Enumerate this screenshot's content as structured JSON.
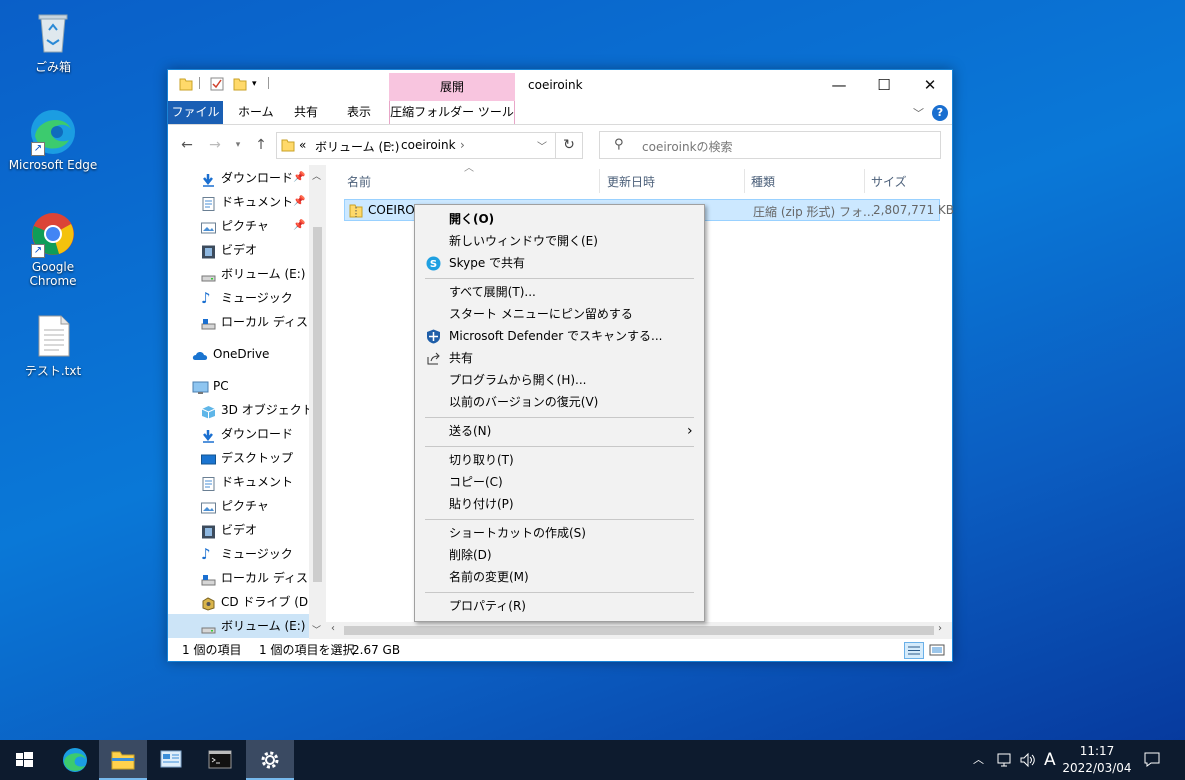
{
  "desktop": {
    "icons": [
      {
        "label": "ごみ箱"
      },
      {
        "label": "Microsoft Edge"
      },
      {
        "label": "Google Chrome"
      },
      {
        "label": "テスト.txt"
      }
    ]
  },
  "window": {
    "title": "coeiroink",
    "context_tab_header": "展開",
    "ribbon_tabs": [
      "ファイル",
      "ホーム",
      "共有",
      "表示"
    ],
    "context_tab": "圧縮フォルダー ツール",
    "help": "?",
    "address": {
      "overflow": "«",
      "crumbs": [
        "ボリューム (E:)",
        "coeiroink"
      ]
    },
    "search_placeholder": "coeiroinkの検索",
    "nav": {
      "quick": [
        "ダウンロード",
        "ドキュメント",
        "ピクチャ",
        "ビデオ",
        "ボリューム (E:)",
        "ミュージック",
        "ローカル ディスク (C"
      ],
      "onedrive": "OneDrive",
      "pc": "PC",
      "pc_items": [
        "3D オブジェクト",
        "ダウンロード",
        "デスクトップ",
        "ドキュメント",
        "ピクチャ",
        "ビデオ",
        "ミュージック",
        "ローカル ディスク (C",
        "CD ドライブ (D:) Vi",
        "ボリューム (E:)"
      ]
    },
    "columns": [
      "名前",
      "更新日時",
      "種類",
      "サイズ"
    ],
    "file": {
      "name": "COEIROINK",
      "type": "圧縮 (zip 形式) フォ...",
      "size": "2,807,771 KB"
    },
    "status": {
      "count": "1 個の項目",
      "selected": "1 個の項目を選択",
      "size": "2.67 GB"
    }
  },
  "context_menu": {
    "open": "開く(O)",
    "open_new_window": "新しいウィンドウで開く(E)",
    "skype": "Skype で共有",
    "extract_all": "すべて展開(T)...",
    "pin_start": "スタート メニューにピン留めする",
    "defender": "Microsoft Defender でスキャンする...",
    "share": "共有",
    "open_with": "プログラムから開く(H)...",
    "restore": "以前のバージョンの復元(V)",
    "send_to": "送る(N)",
    "cut": "切り取り(T)",
    "copy": "コピー(C)",
    "paste": "貼り付け(P)",
    "create_shortcut": "ショートカットの作成(S)",
    "delete": "削除(D)",
    "rename": "名前の変更(M)",
    "properties": "プロパティ(R)"
  },
  "taskbar": {
    "ime": "A",
    "time": "11:17",
    "date": "2022/03/04"
  }
}
